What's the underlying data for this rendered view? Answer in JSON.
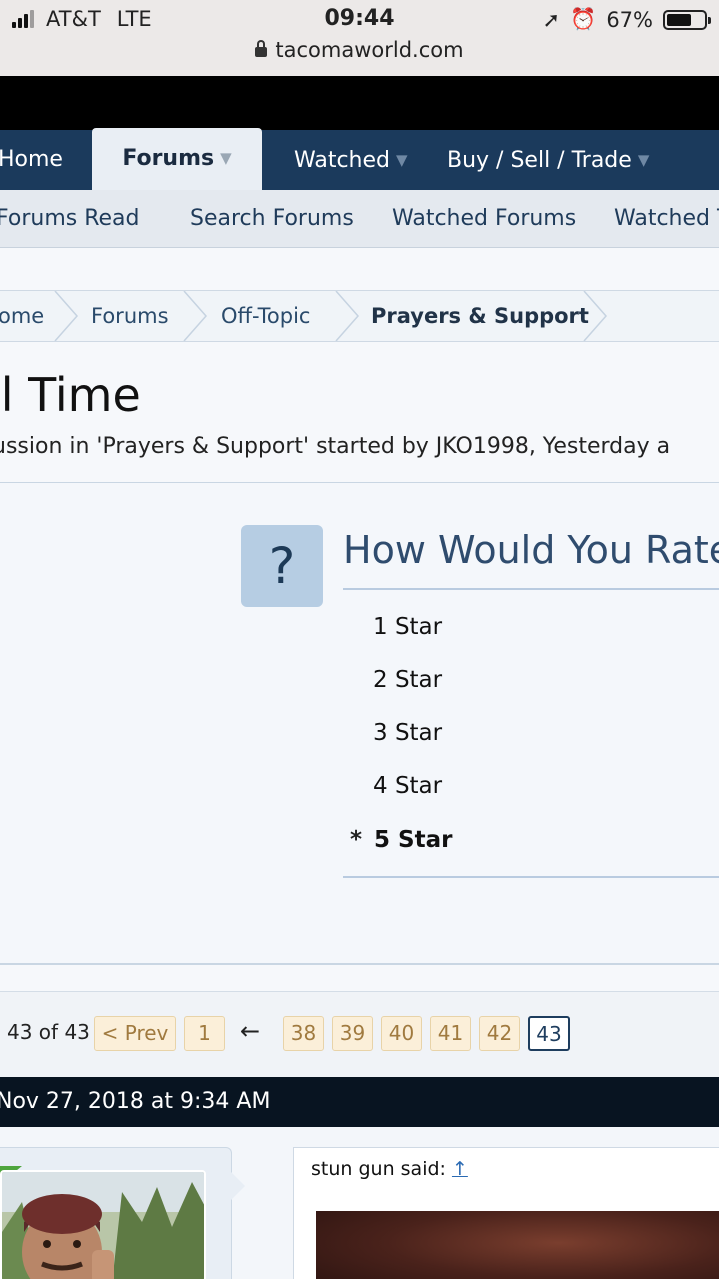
{
  "status": {
    "carrier": "AT&T",
    "network": "LTE",
    "time": "09:44",
    "battery": "67%",
    "battery_level": 0.67,
    "url": "tacomaworld.com"
  },
  "nav": {
    "tabs": [
      {
        "label": "Home"
      },
      {
        "label": "Forums"
      },
      {
        "label": "Watched"
      },
      {
        "label": "Buy / Sell / Trade"
      }
    ],
    "sub": [
      "Forums Read",
      "Search Forums",
      "Watched Forums",
      "Watched T"
    ]
  },
  "breadcrumb": [
    "ome",
    "Forums",
    "Off-Topic",
    "Prayers & Support"
  ],
  "thread": {
    "title": "il Time",
    "meta": "ussion in 'Prayers & Support' started by JKO1998, Yesterday a"
  },
  "poll": {
    "icon": "?",
    "title": "How Would You Rate",
    "options": [
      "1 Star",
      "2 Star",
      "3 Star",
      "4 Star",
      "5 Star"
    ],
    "selected_marker": "*"
  },
  "pager": {
    "text": "43 of 43",
    "prev": "< Prev",
    "first": "1",
    "arrow": "←",
    "pages": [
      "38",
      "39",
      "40",
      "41",
      "42",
      "43"
    ],
    "current": "43"
  },
  "post": {
    "date": "Nov 27, 2018 at 9:34 AM",
    "quote_author": "stun gun said:",
    "quote_link": "↑"
  }
}
